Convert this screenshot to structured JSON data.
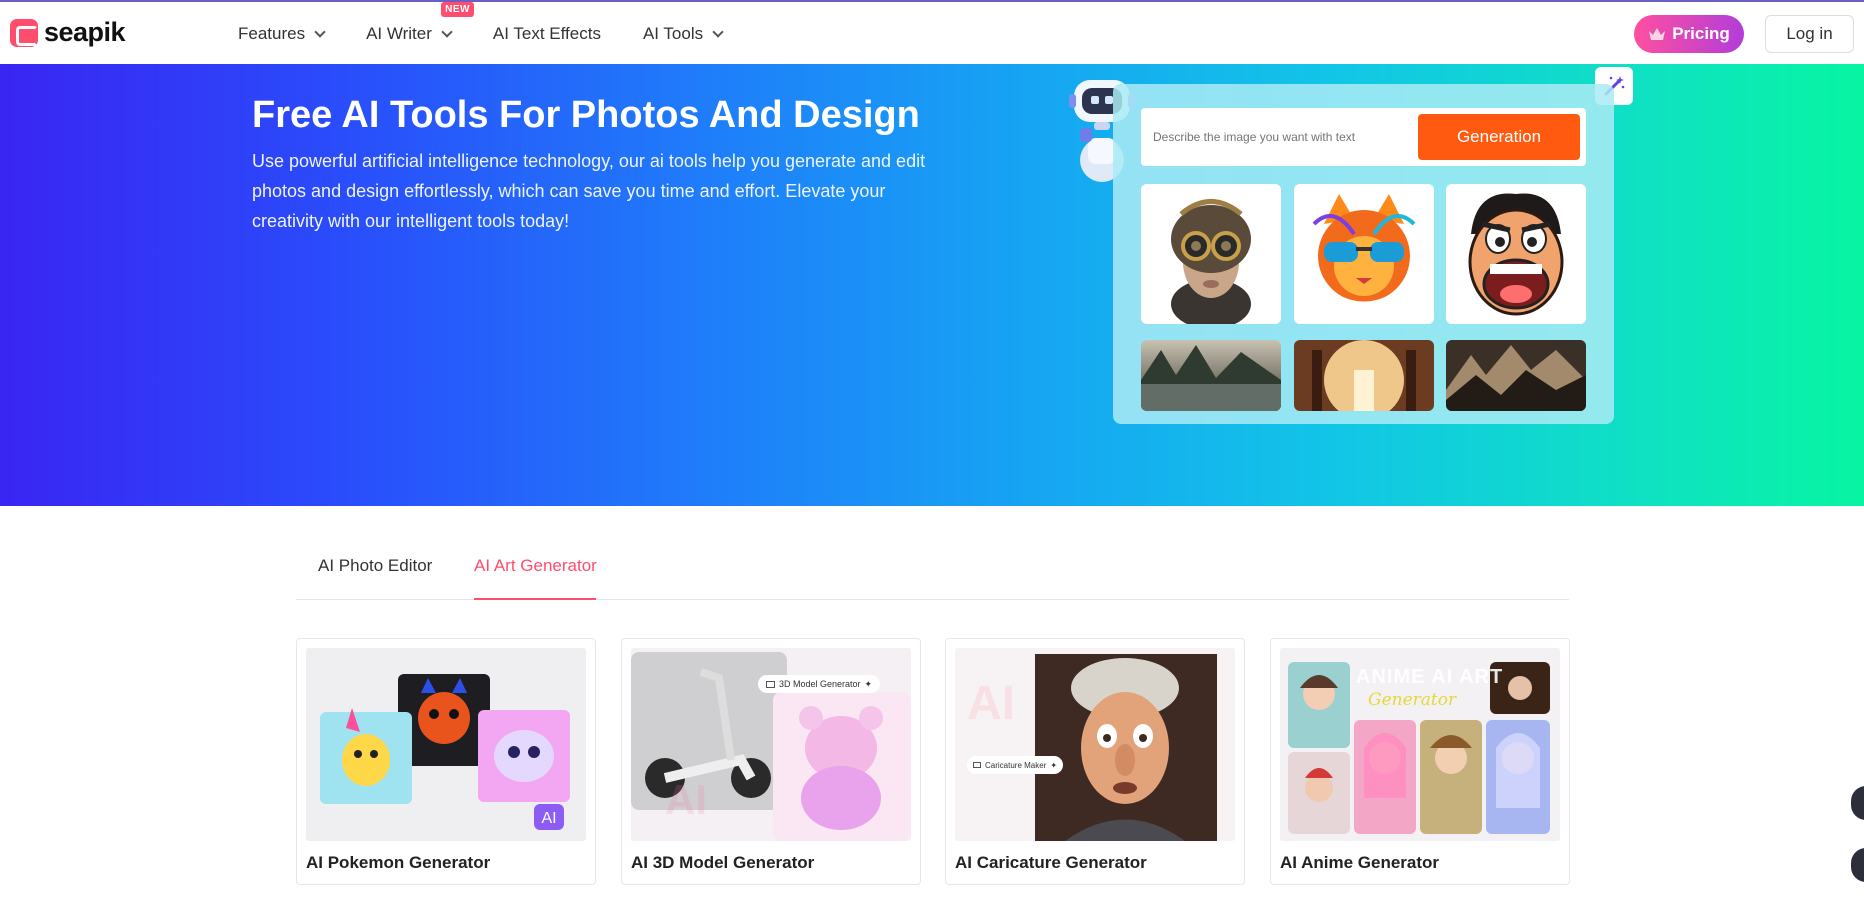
{
  "brand": {
    "name": "seapik"
  },
  "nav": {
    "items": [
      {
        "label": "Features",
        "dropdown": true
      },
      {
        "label": "AI Writer",
        "dropdown": true,
        "badge": "NEW"
      },
      {
        "label": "AI Text Effects",
        "dropdown": false
      },
      {
        "label": "AI Tools",
        "dropdown": true
      }
    ],
    "pricing_label": "Pricing",
    "login_label": "Log in"
  },
  "hero": {
    "title": "Free AI Tools For Photos And Design",
    "description": "Use powerful artificial intelligence technology, our ai tools help you generate and edit photos and design effortlessly, which can save you time and effort. Elevate your creativity with our intelligent tools today!",
    "prompt_placeholder": "Describe the image you want with text",
    "generate_label": "Generation"
  },
  "tabs": [
    {
      "label": "AI Photo Editor",
      "active": false
    },
    {
      "label": "AI Art Generator",
      "active": true
    }
  ],
  "cards": [
    {
      "title": "AI Pokemon Generator"
    },
    {
      "title": "AI 3D Model Generator",
      "tag": "3D Model Generator",
      "watermark": "AI"
    },
    {
      "title": "AI Caricature Generator",
      "tag": "Caricature Maker",
      "watermark": "AI"
    },
    {
      "title": "AI Anime Generator",
      "banner": "ANIME AI ART",
      "banner_sub": "Generator"
    }
  ],
  "colors": {
    "accent": "#ff4d6d",
    "generate_button": "#ff5a10",
    "hero_gradient_start": "#3a25f2",
    "hero_gradient_end": "#07f5a2"
  }
}
